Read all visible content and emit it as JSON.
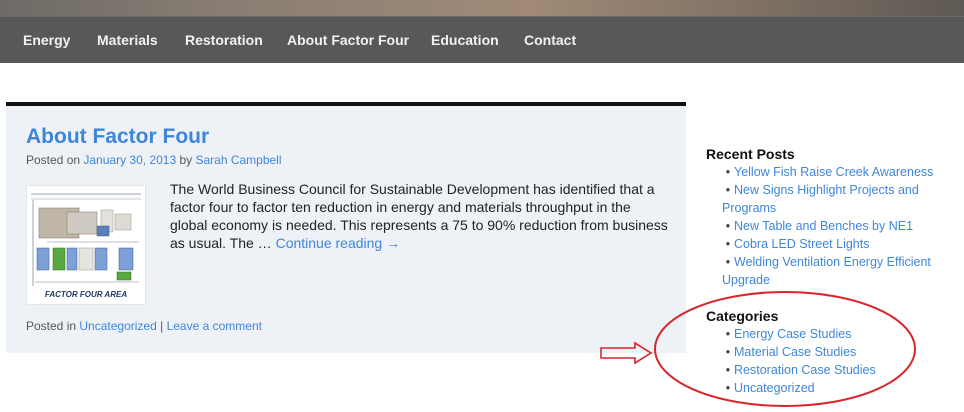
{
  "nav": {
    "items": [
      "Energy",
      "Materials",
      "Restoration",
      "About Factor Four",
      "Education",
      "Contact"
    ]
  },
  "post": {
    "title": "About Factor Four",
    "meta_prefix": "Posted on ",
    "date": "January 30, 2013",
    "meta_by": " by ",
    "author": "Sarah Campbell",
    "thumbnail_caption": "FACTOR FOUR AREA",
    "excerpt": "The World Business Council for Sustainable Development has identified that a factor four to factor ten reduction in energy and materials throughput in the global economy is needed. This represents a 75 to 90% reduction from business as usual. The … ",
    "continue_reading": "Continue reading →",
    "footer_prefix": "Posted in ",
    "category": "Uncategorized",
    "footer_sep": " | ",
    "comment_link": "Leave a comment"
  },
  "sidebar": {
    "recent_posts_title": "Recent Posts",
    "recent_posts": [
      "Yellow Fish Raise Creek Awareness",
      "New Signs Highlight Projects and Programs",
      "New Table and Benches by NE1",
      "Cobra LED Street Lights",
      "Welding Ventilation Energy Efficient Upgrade"
    ],
    "categories_title": "Categories",
    "categories": [
      "Energy Case Studies",
      "Material Case Studies",
      "Restoration Case Studies",
      "Uncategorized"
    ]
  },
  "colors": {
    "nav_bg": "#585858",
    "link": "#3f86d8",
    "post_bg": "#eef2f7",
    "annotation_red": "#d9262b"
  },
  "annotation": {
    "arrow_icon": "right-arrow-icon",
    "circle": "red-ellipse-highlight"
  }
}
